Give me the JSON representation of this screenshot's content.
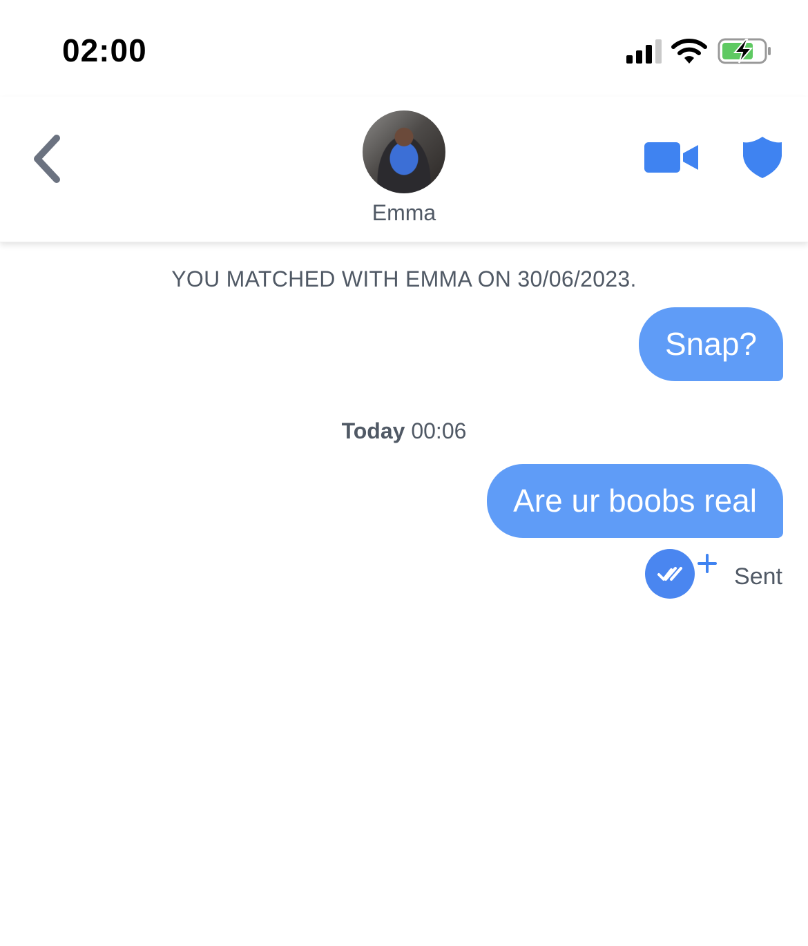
{
  "status_bar": {
    "time": "02:00",
    "icons": [
      "cellular-signal-icon",
      "wifi-icon",
      "battery-charging-icon"
    ]
  },
  "header": {
    "back_icon": "chevron-left-icon",
    "contact_name": "Emma",
    "video_icon": "video-camera-icon",
    "safety_icon": "shield-icon",
    "accent_color": "#3f83f1"
  },
  "chat": {
    "match_note": "YOU MATCHED WITH EMMA ON 30/06/2023.",
    "messages": [
      {
        "text": "Snap?"
      },
      {
        "text": "Are ur boobs real"
      }
    ],
    "timestamp": {
      "day": "Today",
      "time": "00:06"
    },
    "receipt_icon": "double-check-icon",
    "plus_icon": "plus-icon",
    "status": "Sent",
    "bubble_color": "#5f9cf7"
  }
}
